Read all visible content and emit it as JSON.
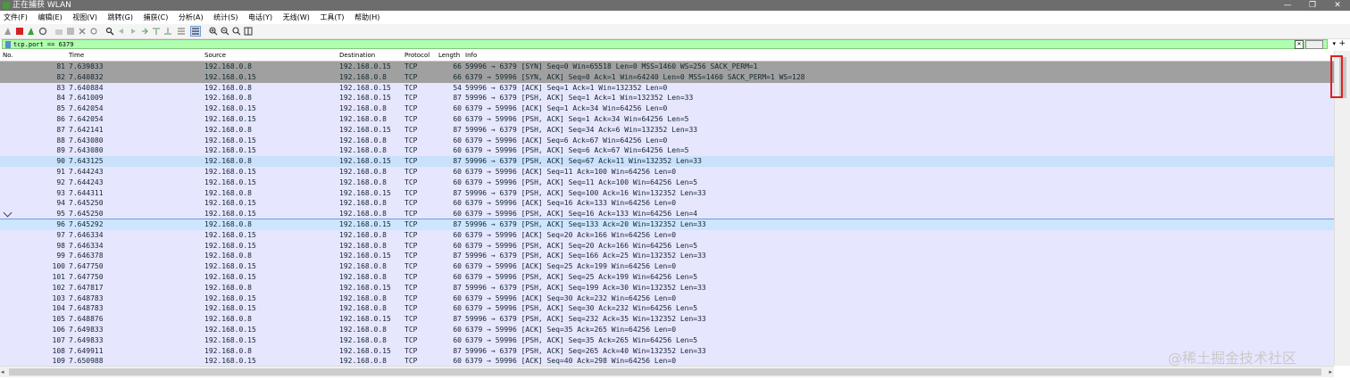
{
  "window": {
    "title": "正在捕获 WLAN",
    "controls": [
      "—",
      "❐",
      "✕"
    ]
  },
  "menu": [
    "文件(F)",
    "编辑(E)",
    "视图(V)",
    "跳转(G)",
    "捕获(C)",
    "分析(A)",
    "统计(S)",
    "电话(Y)",
    "无线(W)",
    "工具(T)",
    "帮助(H)"
  ],
  "filter": {
    "value": "tcp.port == 6379",
    "clear": "✕",
    "dropdown": "▾",
    "add": "+"
  },
  "columns": [
    "No.",
    "Time",
    "Source",
    "Destination",
    "Protocol",
    "Length",
    "Info"
  ],
  "colors": {
    "row_default": "#e7e6ff",
    "row_syn": "#a0a0a0",
    "row_selected_alt": "#c9e1fb",
    "row_selected": "#cde6ff",
    "filter_ok": "#afffaf",
    "highlight_box": "#e02020"
  },
  "packets": [
    {
      "no": "81",
      "time": "7.639833",
      "src": "192.168.0.8",
      "dst": "192.168.0.15",
      "proto": "TCP",
      "len": "66",
      "info": "59996 → 6379 [SYN] Seq=0 Win=65518 Len=0 MSS=1460 WS=256 SACK_PERM=1",
      "style": "syn"
    },
    {
      "no": "82",
      "time": "7.640832",
      "src": "192.168.0.15",
      "dst": "192.168.0.8",
      "proto": "TCP",
      "len": "66",
      "info": "6379 → 59996 [SYN, ACK] Seq=0 Ack=1 Win=64240 Len=0 MSS=1460 SACK_PERM=1 WS=128",
      "style": "syn"
    },
    {
      "no": "83",
      "time": "7.640884",
      "src": "192.168.0.8",
      "dst": "192.168.0.15",
      "proto": "TCP",
      "len": "54",
      "info": "59996 → 6379 [ACK] Seq=1 Ack=1 Win=132352 Len=0",
      "style": "default"
    },
    {
      "no": "84",
      "time": "7.641009",
      "src": "192.168.0.8",
      "dst": "192.168.0.15",
      "proto": "TCP",
      "len": "87",
      "info": "59996 → 6379 [PSH, ACK] Seq=1 Ack=1 Win=132352 Len=33",
      "style": "default"
    },
    {
      "no": "85",
      "time": "7.642054",
      "src": "192.168.0.15",
      "dst": "192.168.0.8",
      "proto": "TCP",
      "len": "60",
      "info": "6379 → 59996 [ACK] Seq=1 Ack=34 Win=64256 Len=0",
      "style": "default"
    },
    {
      "no": "86",
      "time": "7.642054",
      "src": "192.168.0.15",
      "dst": "192.168.0.8",
      "proto": "TCP",
      "len": "60",
      "info": "6379 → 59996 [PSH, ACK] Seq=1 Ack=34 Win=64256 Len=5",
      "style": "default"
    },
    {
      "no": "87",
      "time": "7.642141",
      "src": "192.168.0.8",
      "dst": "192.168.0.15",
      "proto": "TCP",
      "len": "87",
      "info": "59996 → 6379 [PSH, ACK] Seq=34 Ack=6 Win=132352 Len=33",
      "style": "default"
    },
    {
      "no": "88",
      "time": "7.643080",
      "src": "192.168.0.15",
      "dst": "192.168.0.8",
      "proto": "TCP",
      "len": "60",
      "info": "6379 → 59996 [ACK] Seq=6 Ack=67 Win=64256 Len=0",
      "style": "default"
    },
    {
      "no": "89",
      "time": "7.643080",
      "src": "192.168.0.15",
      "dst": "192.168.0.8",
      "proto": "TCP",
      "len": "60",
      "info": "6379 → 59996 [PSH, ACK] Seq=6 Ack=67 Win=64256 Len=5",
      "style": "default"
    },
    {
      "no": "90",
      "time": "7.643125",
      "src": "192.168.0.8",
      "dst": "192.168.0.15",
      "proto": "TCP",
      "len": "87",
      "info": "59996 → 6379 [PSH, ACK] Seq=67 Ack=11 Win=132352 Len=33",
      "style": "alt"
    },
    {
      "no": "91",
      "time": "7.644243",
      "src": "192.168.0.15",
      "dst": "192.168.0.8",
      "proto": "TCP",
      "len": "60",
      "info": "6379 → 59996 [ACK] Seq=11 Ack=100 Win=64256 Len=0",
      "style": "default"
    },
    {
      "no": "92",
      "time": "7.644243",
      "src": "192.168.0.15",
      "dst": "192.168.0.8",
      "proto": "TCP",
      "len": "60",
      "info": "6379 → 59996 [PSH, ACK] Seq=11 Ack=100 Win=64256 Len=5",
      "style": "default"
    },
    {
      "no": "93",
      "time": "7.644311",
      "src": "192.168.0.8",
      "dst": "192.168.0.15",
      "proto": "TCP",
      "len": "87",
      "info": "59996 → 6379 [PSH, ACK] Seq=100 Ack=16 Win=132352 Len=33",
      "style": "default"
    },
    {
      "no": "94",
      "time": "7.645250",
      "src": "192.168.0.15",
      "dst": "192.168.0.8",
      "proto": "TCP",
      "len": "60",
      "info": "6379 → 59996 [ACK] Seq=16 Ack=133 Win=64256 Len=0",
      "style": "default"
    },
    {
      "no": "95",
      "time": "7.645250",
      "src": "192.168.0.15",
      "dst": "192.168.0.8",
      "proto": "TCP",
      "len": "60",
      "info": "6379 → 59996 [PSH, ACK] Seq=16 Ack=133 Win=64256 Len=4",
      "style": "default"
    },
    {
      "no": "96",
      "time": "7.645292",
      "src": "192.168.0.8",
      "dst": "192.168.0.15",
      "proto": "TCP",
      "len": "87",
      "info": "59996 → 6379 [PSH, ACK] Seq=133 Ack=20 Win=132352 Len=33",
      "style": "selected"
    },
    {
      "no": "97",
      "time": "7.646334",
      "src": "192.168.0.15",
      "dst": "192.168.0.8",
      "proto": "TCP",
      "len": "60",
      "info": "6379 → 59996 [ACK] Seq=20 Ack=166 Win=64256 Len=0",
      "style": "default"
    },
    {
      "no": "98",
      "time": "7.646334",
      "src": "192.168.0.15",
      "dst": "192.168.0.8",
      "proto": "TCP",
      "len": "60",
      "info": "6379 → 59996 [PSH, ACK] Seq=20 Ack=166 Win=64256 Len=5",
      "style": "default"
    },
    {
      "no": "99",
      "time": "7.646378",
      "src": "192.168.0.8",
      "dst": "192.168.0.15",
      "proto": "TCP",
      "len": "87",
      "info": "59996 → 6379 [PSH, ACK] Seq=166 Ack=25 Win=132352 Len=33",
      "style": "default"
    },
    {
      "no": "100",
      "time": "7.647750",
      "src": "192.168.0.15",
      "dst": "192.168.0.8",
      "proto": "TCP",
      "len": "60",
      "info": "6379 → 59996 [ACK] Seq=25 Ack=199 Win=64256 Len=0",
      "style": "default"
    },
    {
      "no": "101",
      "time": "7.647750",
      "src": "192.168.0.15",
      "dst": "192.168.0.8",
      "proto": "TCP",
      "len": "60",
      "info": "6379 → 59996 [PSH, ACK] Seq=25 Ack=199 Win=64256 Len=5",
      "style": "default"
    },
    {
      "no": "102",
      "time": "7.647817",
      "src": "192.168.0.8",
      "dst": "192.168.0.15",
      "proto": "TCP",
      "len": "87",
      "info": "59996 → 6379 [PSH, ACK] Seq=199 Ack=30 Win=132352 Len=33",
      "style": "default"
    },
    {
      "no": "103",
      "time": "7.648783",
      "src": "192.168.0.15",
      "dst": "192.168.0.8",
      "proto": "TCP",
      "len": "60",
      "info": "6379 → 59996 [ACK] Seq=30 Ack=232 Win=64256 Len=0",
      "style": "default"
    },
    {
      "no": "104",
      "time": "7.648783",
      "src": "192.168.0.15",
      "dst": "192.168.0.8",
      "proto": "TCP",
      "len": "60",
      "info": "6379 → 59996 [PSH, ACK] Seq=30 Ack=232 Win=64256 Len=5",
      "style": "default"
    },
    {
      "no": "105",
      "time": "7.648876",
      "src": "192.168.0.8",
      "dst": "192.168.0.15",
      "proto": "TCP",
      "len": "87",
      "info": "59996 → 6379 [PSH, ACK] Seq=232 Ack=35 Win=132352 Len=33",
      "style": "default"
    },
    {
      "no": "106",
      "time": "7.649833",
      "src": "192.168.0.15",
      "dst": "192.168.0.8",
      "proto": "TCP",
      "len": "60",
      "info": "6379 → 59996 [ACK] Seq=35 Ack=265 Win=64256 Len=0",
      "style": "default"
    },
    {
      "no": "107",
      "time": "7.649833",
      "src": "192.168.0.15",
      "dst": "192.168.0.8",
      "proto": "TCP",
      "len": "60",
      "info": "6379 → 59996 [PSH, ACK] Seq=35 Ack=265 Win=64256 Len=5",
      "style": "default"
    },
    {
      "no": "108",
      "time": "7.649911",
      "src": "192.168.0.8",
      "dst": "192.168.0.15",
      "proto": "TCP",
      "len": "87",
      "info": "59996 → 6379 [PSH, ACK] Seq=265 Ack=40 Win=132352 Len=33",
      "style": "default"
    },
    {
      "no": "109",
      "time": "7.650988",
      "src": "192.168.0.15",
      "dst": "192.168.0.8",
      "proto": "TCP",
      "len": "60",
      "info": "6379 → 59996 [ACK] Seq=40 Ack=298 Win=64256 Len=0",
      "style": "default"
    }
  ],
  "watermark": "@稀土掘金技术社区"
}
